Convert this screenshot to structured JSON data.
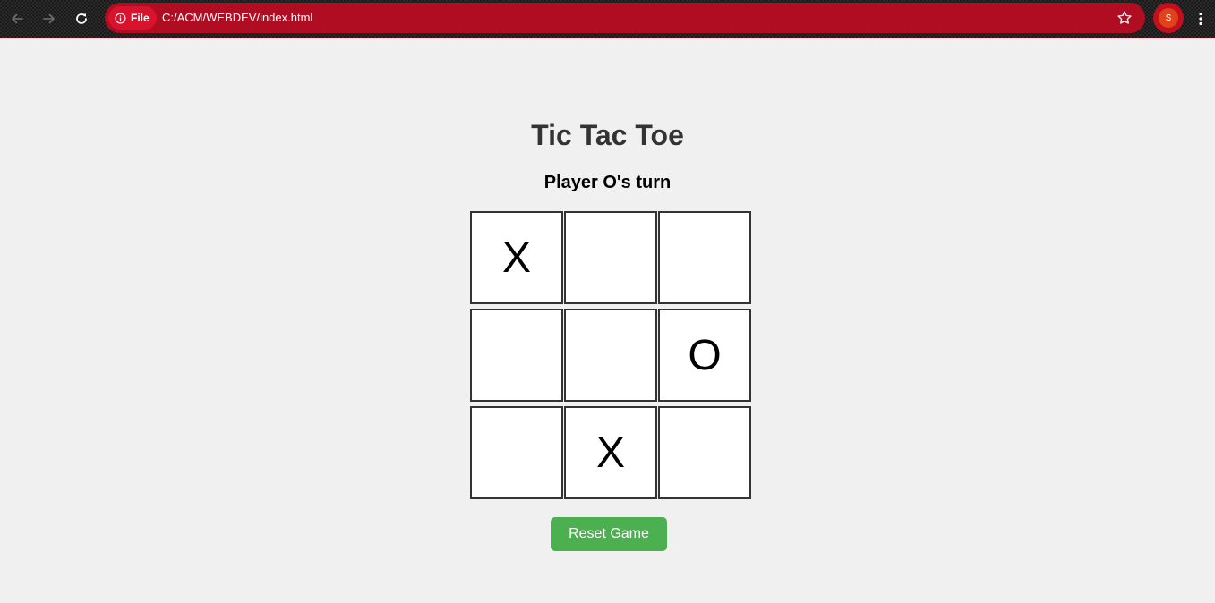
{
  "browser": {
    "security_chip_label": "File",
    "url": "C:/ACM/WEBDEV/index.html",
    "profile_initial": "S",
    "icons": {
      "back": "back-arrow-icon",
      "forward": "forward-arrow-icon",
      "reload": "reload-icon",
      "info": "info-icon",
      "bookmark": "star-icon",
      "menu": "kebab-menu-icon"
    },
    "colors": {
      "omnibox": "#b00d22",
      "chip": "#d9132e",
      "profile": "#c2101f"
    }
  },
  "game": {
    "title": "Tic Tac Toe",
    "status": "Player O's turn",
    "board": [
      "X",
      "",
      "",
      "",
      "",
      "O",
      "",
      "X",
      ""
    ],
    "reset_label": "Reset Game",
    "colors": {
      "background": "#f0f0f0",
      "cell_border": "#333333",
      "reset_button": "#4caf50"
    }
  }
}
